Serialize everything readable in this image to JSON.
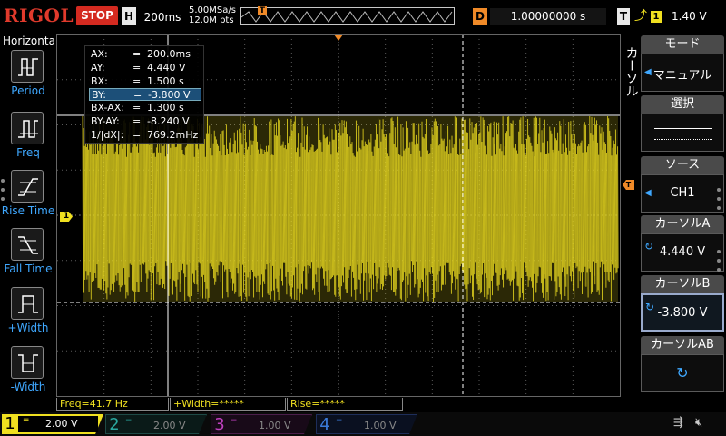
{
  "topbar": {
    "logo": "RIGOL",
    "run_state": "STOP",
    "timebase_label": "H",
    "timebase_value": "200ms",
    "sample_rate": "5.00MSa/s",
    "memory_depth": "12.0M pts",
    "trigger_pos_marker": "T",
    "delay_label": "D",
    "delay_value": "1.00000000 s",
    "trigger_label": "T",
    "trigger_edge": "⌬",
    "trigger_source": "1",
    "trigger_level": "1.40 V",
    "colors": {
      "run_state_bg": "#d42a20",
      "trigger_marker": "#f08a28",
      "channel1": "#f0e020"
    }
  },
  "left_menu": {
    "title": "Horizontal",
    "items": [
      {
        "name": "period",
        "label": "Period",
        "icon": "period-icon"
      },
      {
        "name": "freq",
        "label": "Freq",
        "icon": "freq-icon"
      },
      {
        "name": "rise-time",
        "label": "Rise Time",
        "icon": "rise-time-icon"
      },
      {
        "name": "fall-time",
        "label": "Fall Time",
        "icon": "fall-time-icon"
      },
      {
        "name": "plus-width",
        "label": "+Width",
        "icon": "plus-width-icon"
      },
      {
        "name": "minus-width",
        "label": "-Width",
        "icon": "minus-width-icon"
      }
    ]
  },
  "cursor_readout": {
    "rows": [
      {
        "key": "AX:",
        "value": "200.0ms"
      },
      {
        "key": "AY:",
        "value": "4.440 V"
      },
      {
        "key": "BX:",
        "value": "1.500 s"
      },
      {
        "key": "BY:",
        "value": "-3.800 V"
      },
      {
        "key": "BX-AX:",
        "value": "1.300 s"
      },
      {
        "key": "BY-AY:",
        "value": "-8.240 V"
      },
      {
        "key": "1/|dX|:",
        "value": "769.2mHz"
      }
    ],
    "equals": "=",
    "selected_row": 3
  },
  "screen": {
    "channel1_marker": "1",
    "trigger_level_marker": "T"
  },
  "right_menu": {
    "side_title": "カーソル",
    "items": [
      {
        "title": "モード",
        "value": "マニュアル",
        "control": "arrow"
      },
      {
        "title": "選択",
        "value": "",
        "control": "none"
      },
      {
        "title": "ソース",
        "value": "CH1",
        "control": "arrow"
      },
      {
        "title": "カーソルA",
        "value": "4.440 V",
        "control": "knob"
      },
      {
        "title": "カーソルB",
        "value": "-3.800 V",
        "control": "knob"
      },
      {
        "title": "カーソルAB",
        "value": "",
        "control": "knob"
      }
    ],
    "selected_index": 4
  },
  "measurements": [
    {
      "label": "Freq=41.7 Hz"
    },
    {
      "label": "+Width=*****"
    },
    {
      "label": "Rise=*****"
    }
  ],
  "channels": [
    {
      "num": "1",
      "scale": "2.00 V",
      "active": true,
      "color": "#f0e020"
    },
    {
      "num": "2",
      "scale": "2.00 V",
      "active": false,
      "color": "#2aa8a0"
    },
    {
      "num": "3",
      "scale": "1.00 V",
      "active": false,
      "color": "#c040c0"
    },
    {
      "num": "4",
      "scale": "1.00 V",
      "active": false,
      "color": "#3a7ad8"
    }
  ],
  "status_icons": [
    "usb-icon",
    "speaker-muted-icon"
  ]
}
